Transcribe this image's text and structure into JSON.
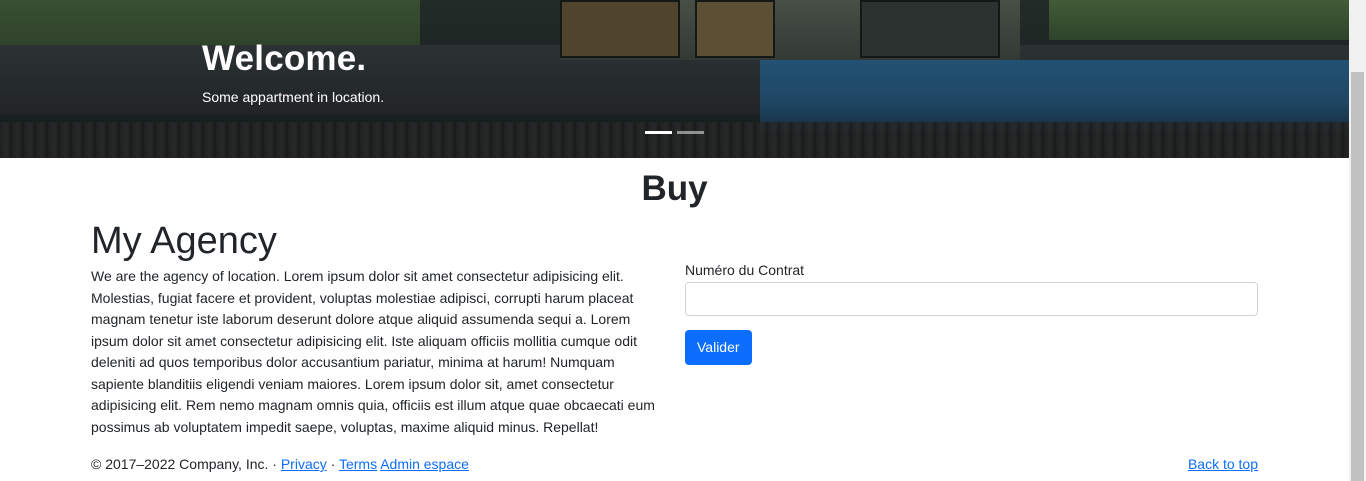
{
  "hero": {
    "title": "Welcome.",
    "subtitle": "Some appartment in location.",
    "indicators": [
      {
        "active": true
      },
      {
        "active": false
      }
    ]
  },
  "main": {
    "heading": "Buy",
    "agency_title": "My Agency",
    "agency_text": "We are the agency of location. Lorem ipsum dolor sit amet consectetur adipisicing elit. Molestias, fugiat facere et provident, voluptas molestiae adipisci, corrupti harum placeat magnam tenetur iste laborum deserunt dolore atque aliquid assumenda sequi a. Lorem ipsum dolor sit amet consectetur adipisicing elit. Iste aliquam officiis mollitia cumque odit deleniti ad quos temporibus dolor accusantium pariatur, minima at harum! Numquam sapiente blanditiis eligendi veniam maiores. Lorem ipsum dolor sit, amet consectetur adipisicing elit. Rem nemo magnam omnis quia, officiis est illum atque quae obcaecati eum possimus ab voluptatem impedit saepe, voluptas, maxime aliquid minus. Repellat!"
  },
  "form": {
    "contract_label": "Numéro du Contrat",
    "contract_value": "",
    "submit_label": "Valider"
  },
  "footer": {
    "copyright": "© 2017–2022 Company, Inc. · ",
    "privacy": "Privacy",
    "separator": " · ",
    "terms": "Terms",
    "admin": "Admin espace",
    "back_to_top": "Back to top"
  },
  "colors": {
    "primary": "#0d6efd",
    "text": "#212529"
  }
}
